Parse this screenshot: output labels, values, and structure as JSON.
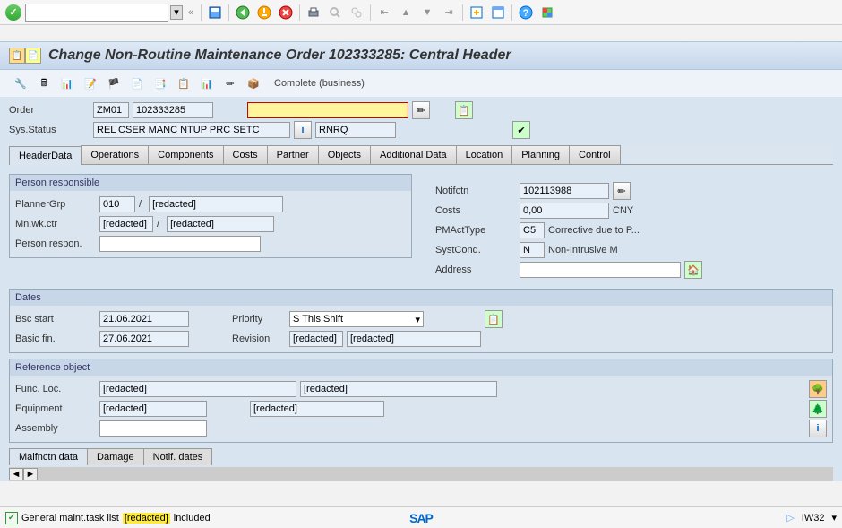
{
  "title": "Change Non-Routine Maintenance Order 102333285: Central Header",
  "app_toolbar": {
    "complete_business": "Complete (business)"
  },
  "header": {
    "order_label": "Order",
    "order_type": "ZM01",
    "order_number": "102333285",
    "sys_status_label": "Sys.Status",
    "sys_status": "REL   CSER  MANC  NTUP  PRC   SETC",
    "sys_status2": "RNRQ"
  },
  "tabs": [
    "HeaderData",
    "Operations",
    "Components",
    "Costs",
    "Partner",
    "Objects",
    "Additional Data",
    "Location",
    "Planning",
    "Control"
  ],
  "person": {
    "title": "Person responsible",
    "planner_grp_label": "PlannerGrp",
    "planner_grp": "010",
    "planner_grp_sep": " / ",
    "planner_grp_desc": "[redacted]",
    "mnwkctr_label": "Mn.wk.ctr",
    "mnwkctr": "[redacted]",
    "mnwkctr_sep": " / ",
    "mnwkctr_desc": "[redacted]",
    "person_respon_label": "Person respon."
  },
  "right": {
    "notifctn_label": "Notifctn",
    "notifctn": "102113988",
    "costs_label": "Costs",
    "costs": "0,00",
    "currency": "CNY",
    "pmacttype_label": "PMActType",
    "pmacttype": "C5",
    "pmacttype_desc": "Corrective due to P...",
    "systcond_label": "SystCond.",
    "systcond": "N",
    "systcond_desc": "Non-Intrusive M",
    "address_label": "Address"
  },
  "dates": {
    "title": "Dates",
    "bsc_start_label": "Bsc start",
    "bsc_start": "21.06.2021",
    "basic_fin_label": "Basic fin.",
    "basic_fin": "27.06.2021",
    "priority_label": "Priority",
    "priority": "S This Shift",
    "revision_label": "Revision",
    "revision": "[redacted]",
    "revision_desc": "[redacted]"
  },
  "refobj": {
    "title": "Reference object",
    "func_loc_label": "Func. Loc.",
    "func_loc": "[redacted]",
    "func_loc_desc": "[redacted]",
    "equipment_label": "Equipment",
    "equipment": "[redacted]",
    "equipment_desc": "[redacted]",
    "assembly_label": "Assembly"
  },
  "subtabs": [
    "Malfnctn data",
    "Damage",
    "Notif. dates"
  ],
  "status": {
    "msg_prefix": "General maint.task list ",
    "msg_redacted": "[redacted]",
    "msg_suffix": " included",
    "tcode": "IW32"
  }
}
